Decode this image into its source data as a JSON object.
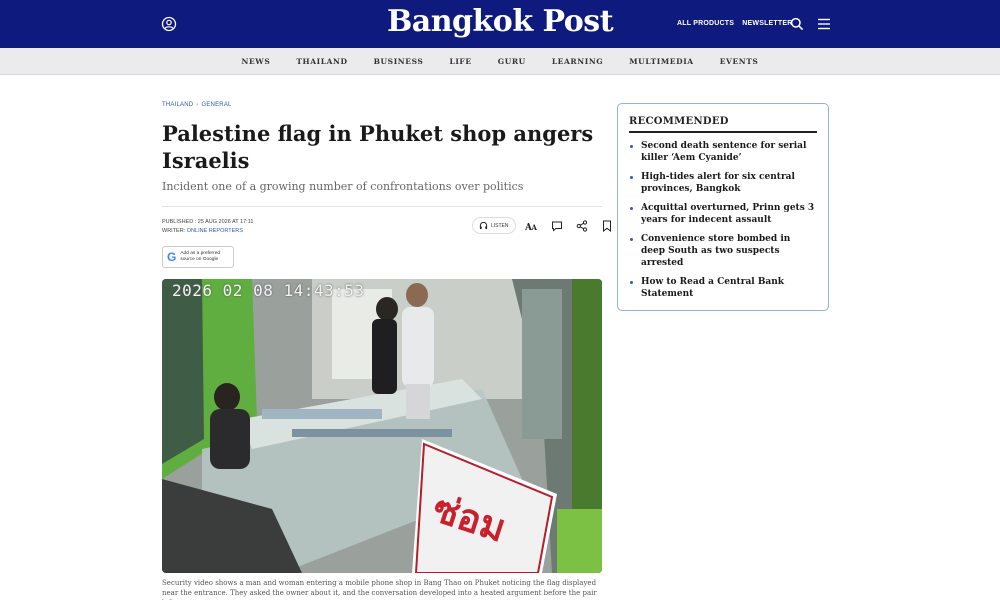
{
  "header": {
    "logo": "Bangkok Post",
    "links": [
      "ALL PRODUCTS",
      "NEWSLETTER"
    ],
    "bg": "#0e1a7e"
  },
  "nav": [
    "NEWS",
    "THAILAND",
    "BUSINESS",
    "LIFE",
    "GURU",
    "LEARNING",
    "MULTIMEDIA",
    "EVENTS"
  ],
  "breadcrumb": [
    "THAILAND",
    "GENERAL"
  ],
  "article": {
    "title": "Palestine flag in Phuket shop angers Israelis",
    "subtitle": "Incident one of a growing number of confrontations over politics",
    "published": "PUBLISHED : 25 AUG 2026 AT 17:11",
    "writer_label": "WRITER:",
    "writer": "ONLINE REPORTERS",
    "listen": "LISTEN",
    "google_badge": "Add as a preferred source on Google",
    "photo_timestamp": "2026 02 08 14:43:53",
    "photo_sign": "ซ่อม",
    "caption": "Security video shows a man and woman entering a mobile phone shop in Bang Thao on Phuket noticing the flag displayed near the entrance. They asked the owner about it, and the conversation developed into a heated argument before the pair left."
  },
  "recommended": {
    "heading": "RECOMMENDED",
    "items": [
      "Second death sentence for serial killer ‘Aem Cyanide’",
      "High-tides alert for six central provinces, Bangkok",
      "Acquittal overturned, Prinn gets 3 years for indecent assault",
      "Convenience store bombed in deep South as two suspects arrested",
      "How to Read a Central Bank Statement"
    ]
  }
}
